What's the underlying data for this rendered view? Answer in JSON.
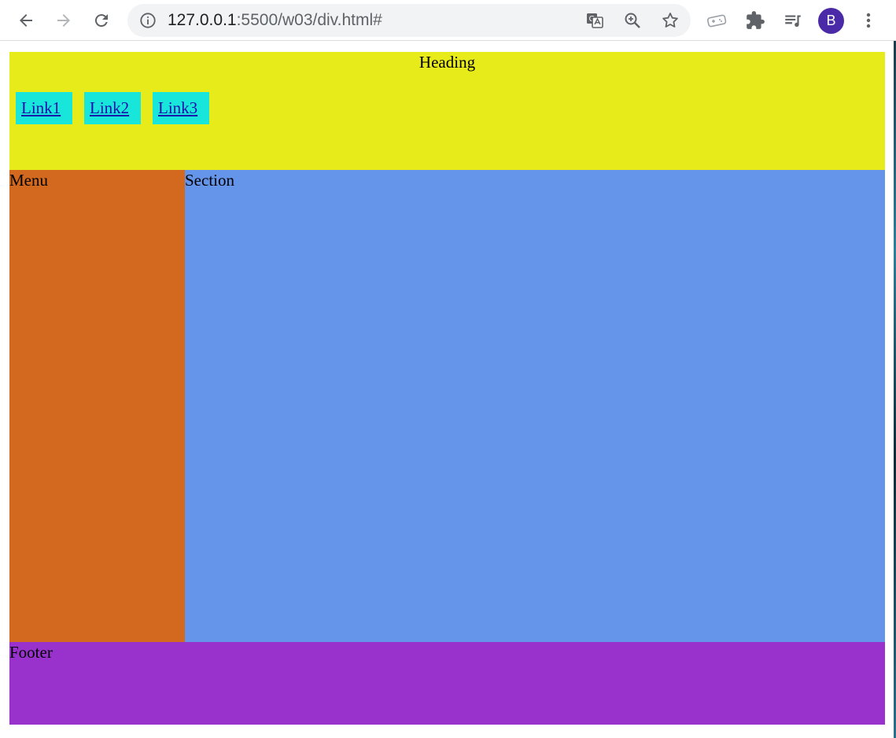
{
  "browser": {
    "url_host": "127.0.0.1",
    "url_rest": ":5500/w03/div.html#",
    "profile_initial": "B",
    "icons": [
      "back-arrow-icon",
      "forward-arrow-icon",
      "reload-icon",
      "info-icon",
      "translate-icon",
      "zoom-icon",
      "star-icon",
      "game-controller-icon",
      "puzzle-icon",
      "media-queue-icon",
      "more-vert-icon"
    ]
  },
  "page": {
    "heading": "Heading",
    "links": [
      {
        "label": "Link1"
      },
      {
        "label": "Link2"
      },
      {
        "label": "Link3"
      }
    ],
    "menu_label": "Menu",
    "section_label": "Section",
    "footer_label": "Footer"
  },
  "colors": {
    "header": "#e8eb1a",
    "link_bg": "#18e6da",
    "menu": "#d2691e",
    "section": "#6495ea",
    "footer": "#9932cc",
    "avatar": "#4a2aa6"
  }
}
